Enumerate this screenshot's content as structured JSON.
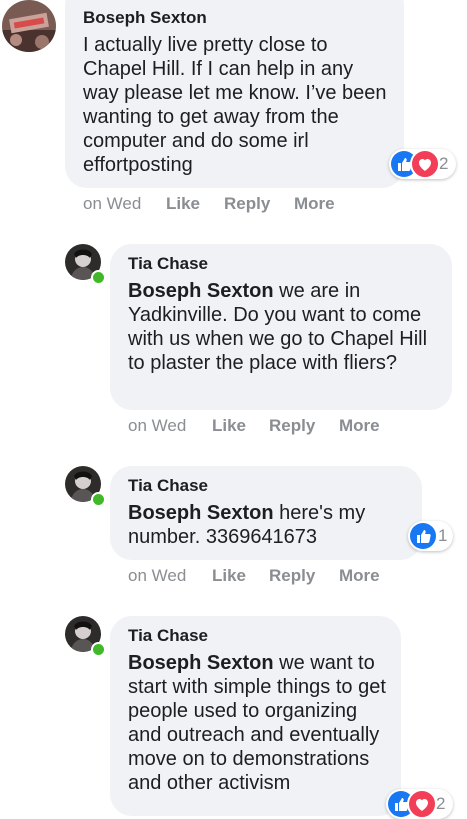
{
  "comments": [
    {
      "author": "Boseph Sexton",
      "text": "I actually live pretty close to Chapel Hill. If I can help in any way please let me know. I’ve been wanting to get away from the computer and do some irl effortposting",
      "time": "on Wed",
      "reaction_count": "2",
      "reactions": [
        "like-icon",
        "love-icon"
      ]
    },
    {
      "author": "Tia Chase",
      "mention": "Boseph Sexton",
      "text": " we are in Yadkinville. Do you want to come with us when we go to Chapel Hill to plaster the place with fliers?",
      "time": "on Wed"
    },
    {
      "author": "Tia Chase",
      "mention": "Boseph Sexton",
      "text": " here's my number. 3369641673",
      "time": "on Wed",
      "reaction_count": "1",
      "reactions": [
        "like-icon"
      ]
    },
    {
      "author": "Tia Chase",
      "mention": "Boseph Sexton",
      "text": " we want to start with simple things to get people used to organizing and outreach and eventually move on to demonstrations and other activism",
      "reaction_count": "2",
      "reactions": [
        "like-icon",
        "love-icon"
      ]
    }
  ],
  "actions": {
    "like": "Like",
    "reply": "Reply",
    "more": "More"
  },
  "colors": {
    "bubble": "#f0f2f5",
    "like_blue": "#1877f2",
    "love_red": "#f33e58",
    "online": "#42b72a",
    "meta": "#8a8d91"
  }
}
